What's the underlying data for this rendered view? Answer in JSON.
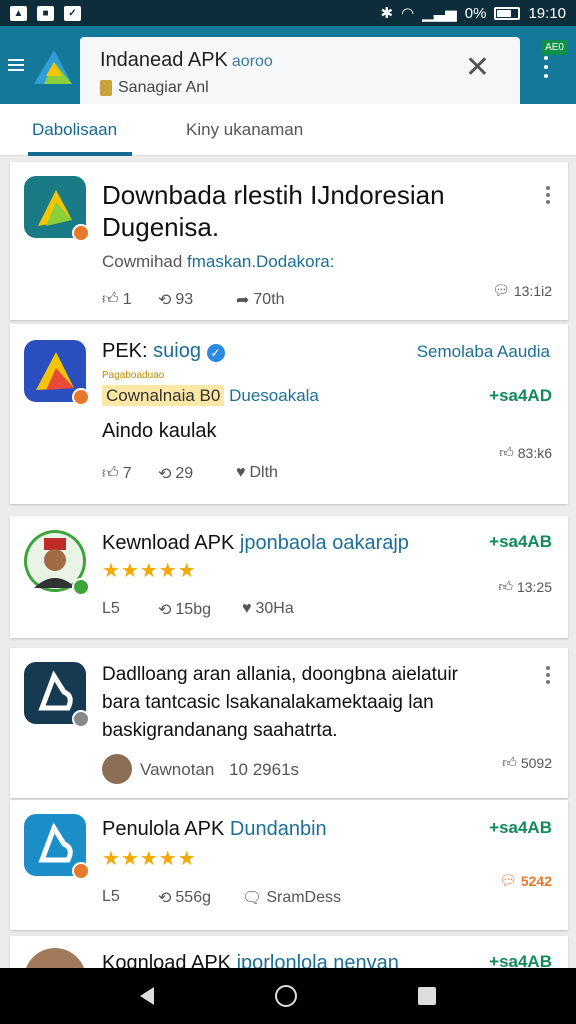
{
  "status_bar": {
    "battery": "0%",
    "time": "19:10"
  },
  "header": {
    "title": "Indanead APK",
    "title_small": "aoroo",
    "subtitle": "Sanagiar Anl",
    "badge": "AE0"
  },
  "tabs": [
    {
      "label": "Dabolisaan"
    },
    {
      "label": "Kiny ukanaman"
    }
  ],
  "posts": [
    {
      "title_line1": "Downbada rlestih IJndoresian",
      "title_line2": "Dugenisa.",
      "sub_plain": "Cowmihad",
      "sub_link": "fmaskan.Dodakora:",
      "likes": "1",
      "reposts": "93",
      "shares": "70th",
      "count": "13:1i2"
    },
    {
      "name": "PEK:",
      "handle": "suiog",
      "category": "Semolaba Aaudia",
      "tag_small": "Pagaboaduao",
      "chip": "Cownalnaia B0",
      "chip_link": "Duesoakala",
      "green": "+sa4AD",
      "body": "Aindo kaulak",
      "likes": "7",
      "reposts": "29",
      "hearts": "Dlth",
      "count": "83:k6"
    },
    {
      "title": "Kewnload APK",
      "link": "jponbaola oakarajp",
      "green": "+sa4AB",
      "likes": "L5",
      "reposts": "15bg",
      "hearts": "30Ha",
      "count": "13:25"
    },
    {
      "line1": "Dadlloang aran allania, doongbna aielatuir",
      "line2": "bara tantcasic lsakanalakamektaaig lan",
      "line3": "baskigrandanang saahatrta.",
      "author": "Vawnotan",
      "date": "10 2961s",
      "count": "5092"
    },
    {
      "title": "Penulola APK",
      "link": "Dundanbin",
      "green": "+sa4AB",
      "likes": "L5",
      "reposts": "556g",
      "speech": "SramDess",
      "count": "5242"
    },
    {
      "title": "Kognload APK",
      "link": "iporlonlola nenvan",
      "green": "+sa4AB"
    }
  ]
}
